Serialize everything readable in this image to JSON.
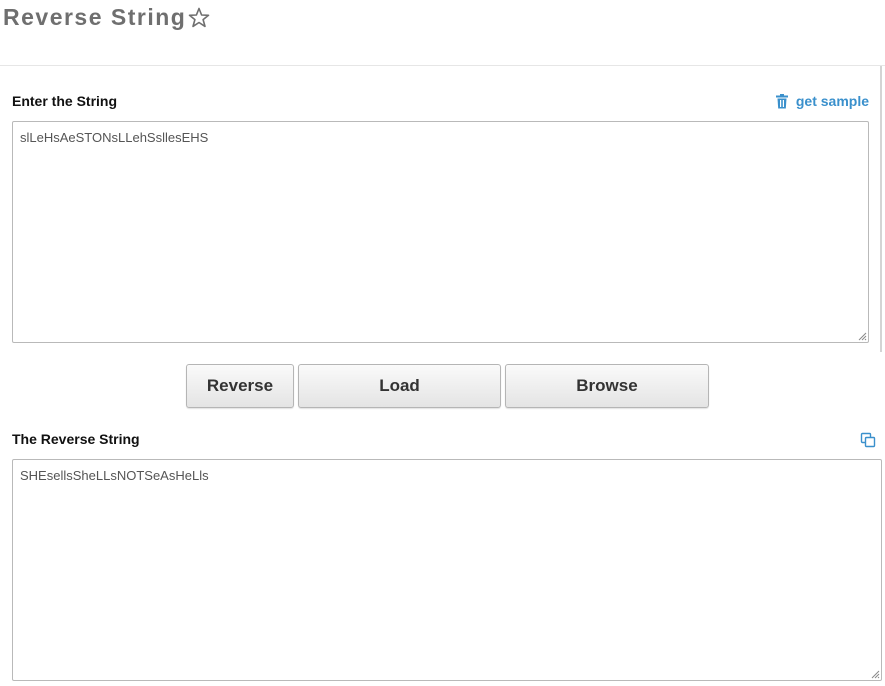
{
  "page": {
    "title": "Reverse String",
    "favorite_icon": "star-outline-icon"
  },
  "input": {
    "label": "Enter the String",
    "get_sample_label": "get sample",
    "get_sample_icon": "trash-icon",
    "value": "slLeHsAeSTONsLLehSsllesEHS"
  },
  "buttons": {
    "reverse": "Reverse",
    "load": "Load",
    "browse": "Browse"
  },
  "output": {
    "label": "The Reverse String",
    "copy_icon": "copy-icon",
    "value": "SHEsellsSheLLsNOTSeAsHeLls"
  },
  "colors": {
    "title": "#6f6f6f",
    "link": "#3a90cc",
    "border": "#b9b9b9"
  }
}
